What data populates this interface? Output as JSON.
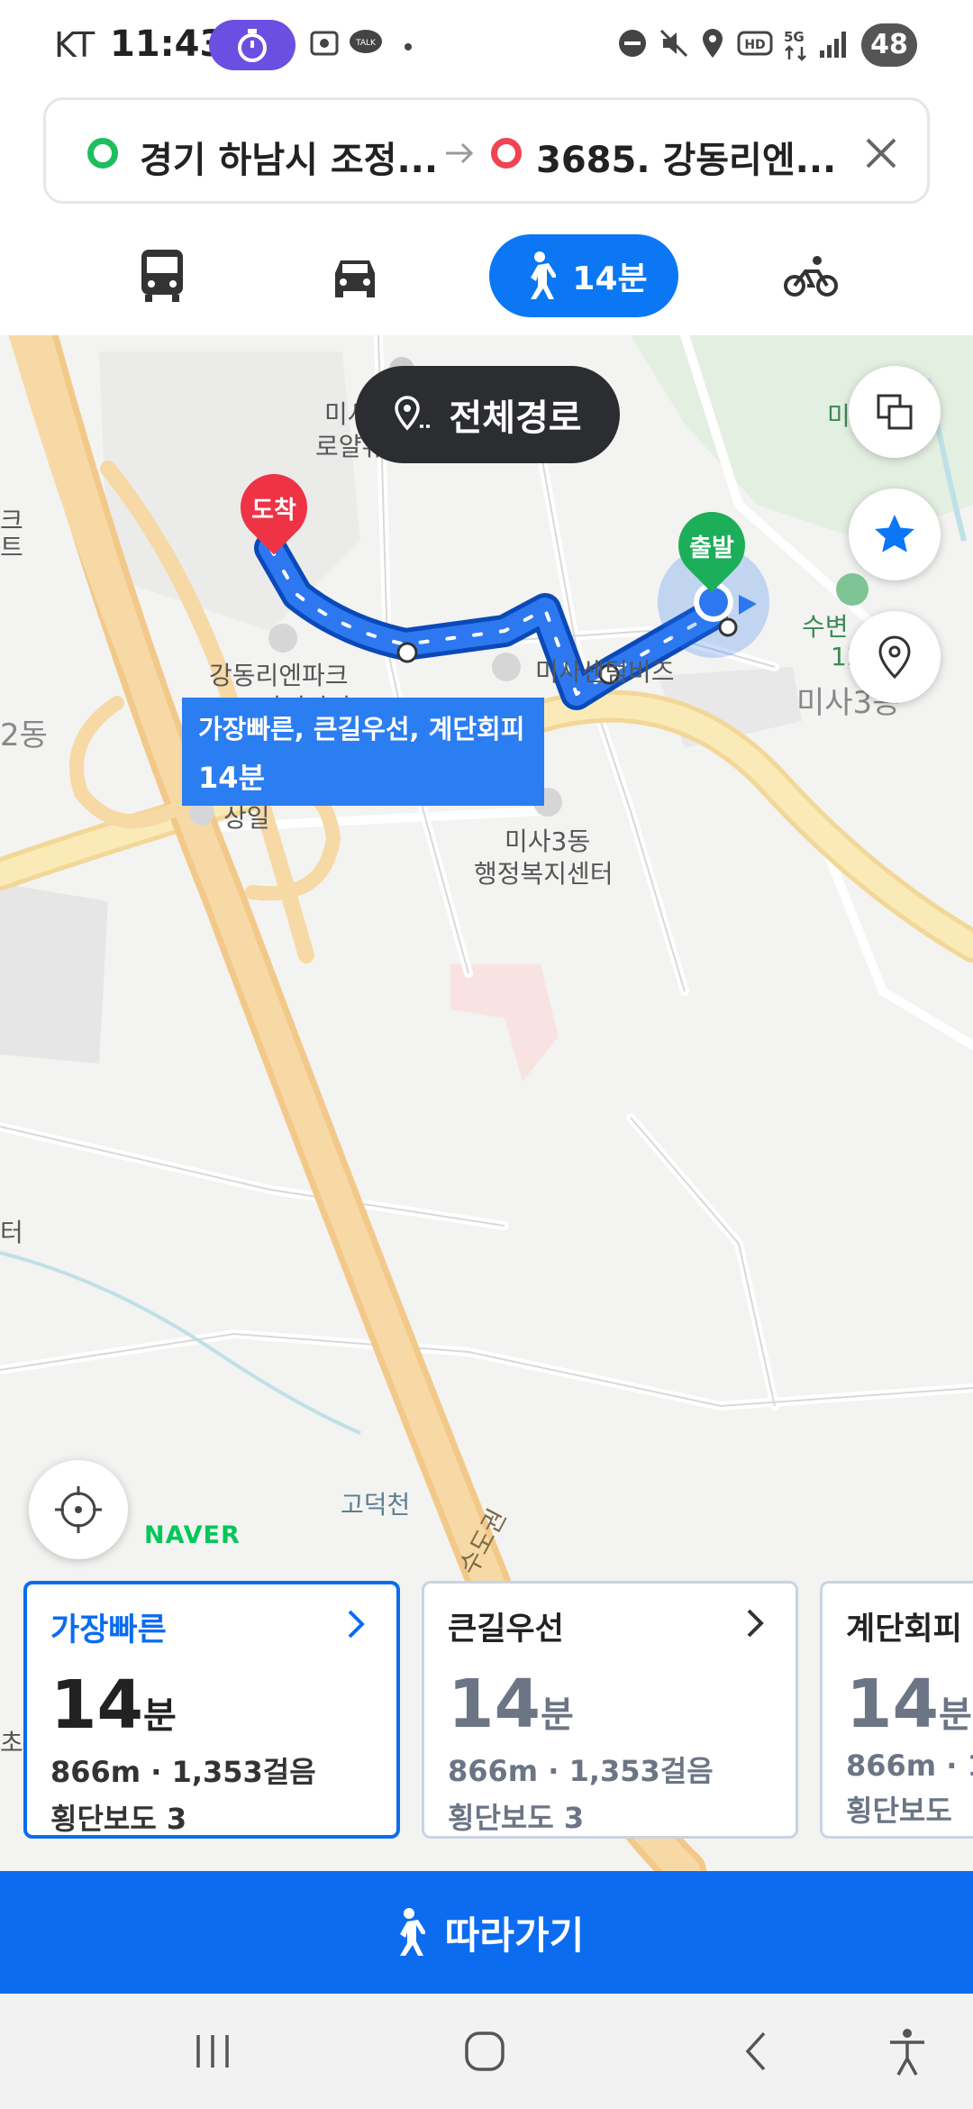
{
  "status_bar": {
    "carrier": "KT",
    "time": "11:43",
    "battery": "48",
    "icons": [
      "timer-icon",
      "gallery-icon",
      "talk-icon",
      "dot-icon",
      "dnd-icon",
      "mute-icon",
      "location-icon",
      "hd-icon",
      "5g-icon",
      "signal-icon"
    ]
  },
  "route": {
    "origin": "경기 하남시 조정...",
    "destination": "3685. 강동리엔...",
    "colors": {
      "origin": "#1dbe5e",
      "destination": "#f04452"
    }
  },
  "mode_tabs": {
    "items": [
      "bus-icon",
      "car-icon",
      "walk-icon",
      "bike-icon"
    ],
    "active": "walk",
    "active_label": "14분"
  },
  "map": {
    "whole_route_label": "전체경로",
    "start_pin": "출발",
    "end_pin": "도착",
    "route_tip": {
      "line1": "가장빠른, 큰길우선, 계단회피",
      "line2": "14분"
    },
    "labels": {
      "apt1": "미사",
      "apt1b": "로얄듀크아파트",
      "gangdong": "강동리엔파크",
      "gangdong2": "14단지아파트",
      "bizz": "미사센텀비즈",
      "ic": "상일",
      "center1": "미사3동",
      "center2": "행정복지센터",
      "misa3": "미사3동",
      "subyeon": "수변",
      "gyeong13": "13",
      "dong2": "2동",
      "godeok": "고덕천",
      "sudo": "수도권",
      "left1": "크",
      "left2": "트",
      "left3": "터",
      "mi": "미",
      "cho": "초"
    },
    "brand": "NAVER",
    "accent": "#0b77f5"
  },
  "cards": [
    {
      "title": "가장빠른",
      "minutes": "14",
      "unit": "분",
      "distance": "866m · 1,353걸음",
      "crosswalk": "횡단보도 3",
      "selected": true
    },
    {
      "title": "큰길우선",
      "minutes": "14",
      "unit": "분",
      "distance": "866m · 1,353걸음",
      "crosswalk": "횡단보도 3",
      "selected": false
    },
    {
      "title": "계단회피",
      "minutes": "14",
      "unit": "분",
      "distance": "866m · 1,",
      "crosswalk": "횡단보도",
      "selected": false
    }
  ],
  "follow_button": {
    "label": "따라가기"
  }
}
